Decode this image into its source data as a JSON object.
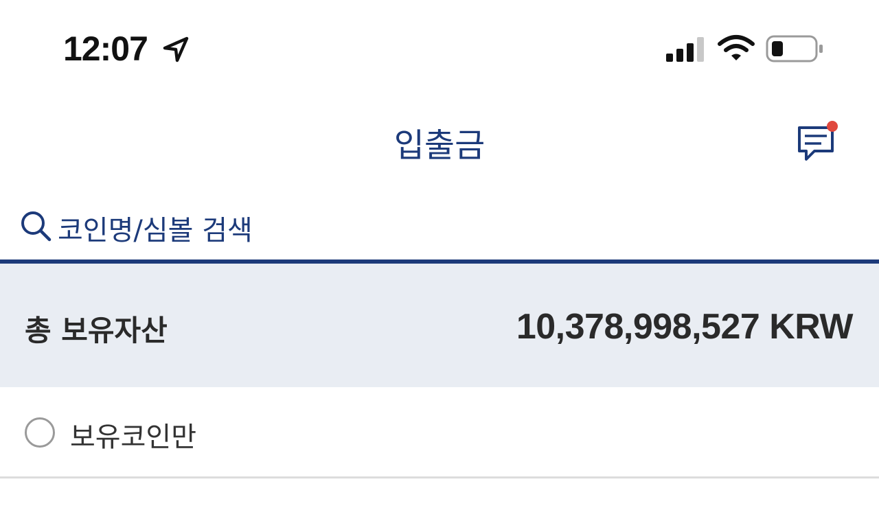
{
  "status_bar": {
    "time": "12:07",
    "icons": [
      "location-arrow-icon",
      "cellular-signal-icon",
      "wifi-icon",
      "battery-icon"
    ]
  },
  "header": {
    "title": "입출금",
    "message_icon": "message-icon",
    "has_notification_dot": true
  },
  "search": {
    "icon": "search-icon",
    "placeholder": "코인명/심볼 검색"
  },
  "total_assets": {
    "label": "총 보유자산",
    "value": "10,378,998,527 KRW"
  },
  "filter": {
    "label": "보유코인만",
    "checked": false
  },
  "colors": {
    "brand": "#1c3a7a",
    "panel_bg": "#e9edf3",
    "notification_dot": "#e0483e",
    "text_dark": "#2a2a2a"
  }
}
